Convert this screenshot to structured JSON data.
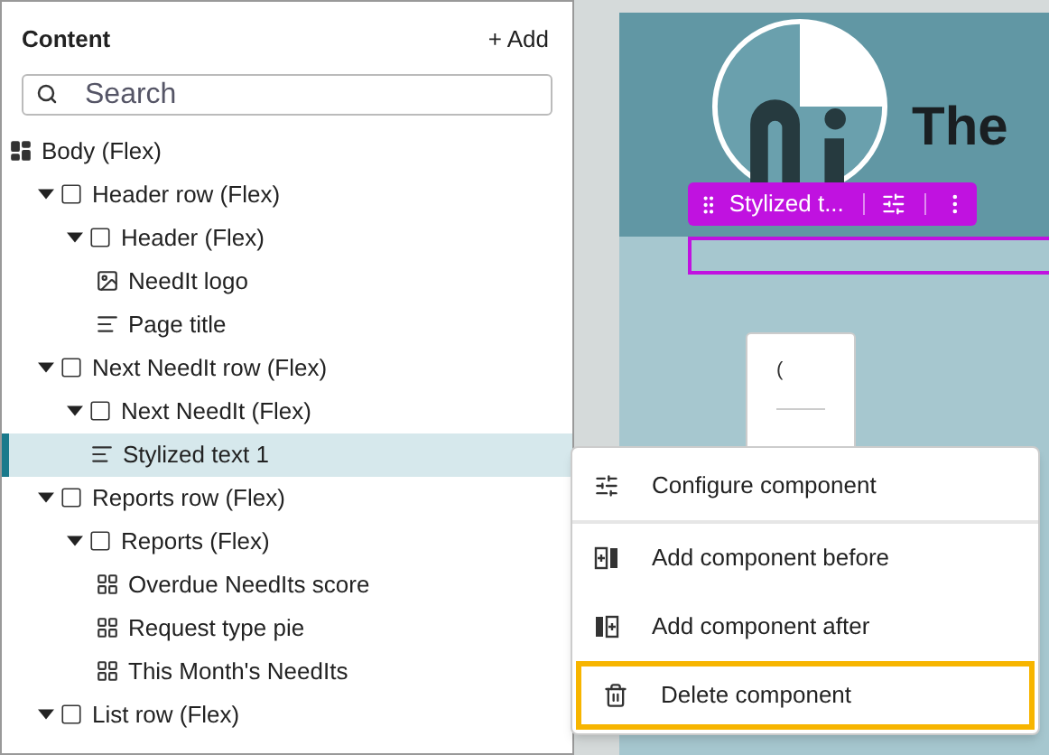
{
  "panel": {
    "title": "Content",
    "add_button": "+ Add",
    "search": {
      "placeholder": "Search"
    }
  },
  "tree": [
    {
      "label": "Body (Flex)",
      "kind": "layout",
      "selected": false,
      "children": [
        {
          "label": "Header row (Flex)",
          "kind": "box",
          "expanded": true,
          "selected": false,
          "children": [
            {
              "label": "Header (Flex)",
              "kind": "box",
              "expanded": true,
              "selected": false,
              "children": [
                {
                  "label": "NeedIt logo",
                  "kind": "image",
                  "selected": false
                },
                {
                  "label": "Page title",
                  "kind": "text",
                  "selected": false
                }
              ]
            }
          ]
        },
        {
          "label": "Next NeedIt row (Flex)",
          "kind": "box",
          "expanded": true,
          "selected": false,
          "children": [
            {
              "label": "Next NeedIt (Flex)",
              "kind": "box",
              "expanded": true,
              "selected": false,
              "children": [
                {
                  "label": "Stylized text 1",
                  "kind": "text",
                  "selected": true
                }
              ]
            }
          ]
        },
        {
          "label": "Reports row (Flex)",
          "kind": "box",
          "expanded": true,
          "selected": false,
          "children": [
            {
              "label": "Reports (Flex)",
              "kind": "box",
              "expanded": true,
              "selected": false,
              "children": [
                {
                  "label": "Overdue NeedIts score",
                  "kind": "component",
                  "selected": false
                },
                {
                  "label": "Request type pie",
                  "kind": "component",
                  "selected": false
                },
                {
                  "label": "This Month's NeedIts",
                  "kind": "component",
                  "selected": false
                }
              ]
            }
          ]
        },
        {
          "label": "List row (Flex)",
          "kind": "box",
          "expanded": true,
          "selected": false
        }
      ]
    }
  ],
  "canvas": {
    "page_title": "The",
    "toolbar_label": "Stylized t...",
    "card_text": "("
  },
  "context_menu": [
    {
      "label": "Configure component",
      "kind": "configure",
      "focused": false
    },
    {
      "label": "Add component before",
      "kind": "before",
      "focused": false
    },
    {
      "label": "Add component after",
      "kind": "after",
      "focused": false
    },
    {
      "label": "Delete component",
      "kind": "delete",
      "focused": true
    }
  ]
}
